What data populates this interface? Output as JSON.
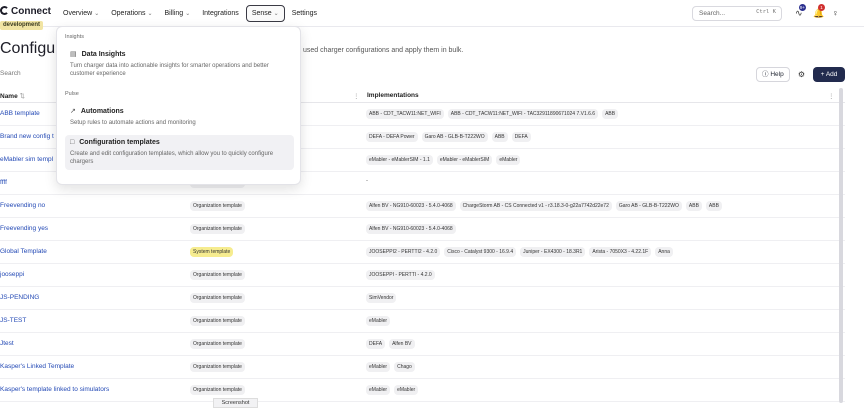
{
  "app": {
    "logo": "Connect",
    "env_badge": "development"
  },
  "nav": [
    {
      "label": "Overview",
      "chevron": true
    },
    {
      "label": "Operations",
      "chevron": true
    },
    {
      "label": "Billing",
      "chevron": true
    },
    {
      "label": "Integrations",
      "chevron": false
    },
    {
      "label": "Sense",
      "chevron": true,
      "active": true
    },
    {
      "label": "Settings",
      "chevron": false
    }
  ],
  "search": {
    "placeholder": "Search...",
    "shortcut": "Ctrl K"
  },
  "header_icons": {
    "activity": "activity-icon",
    "activity_badge": "9+",
    "bell": "bell-icon",
    "bell_badge": "1",
    "user": "user-icon"
  },
  "page": {
    "title": "Configura",
    "subtitle": "used charger configurations and apply them in bulk.",
    "filter_placeholder": "Search",
    "help_label": "Help",
    "add_label": "+ Add"
  },
  "table": {
    "columns": [
      "Name",
      "Implementations"
    ],
    "rows": [
      {
        "name": "ABB template",
        "type": "",
        "impls": [
          "ABB - CDT_TACW11:NET_WIFI",
          "ABB - CDT_TACW11:NET_WIFI - TAC32911890671024 7.V1.6.6",
          "ABB"
        ]
      },
      {
        "name": "Brand new config t",
        "type": "",
        "impls": [
          "DEFA - DEFA Power",
          "Garo AB - GLB-B-T222WO",
          "ABB",
          "DEFA"
        ]
      },
      {
        "name": "eMabler sim templ",
        "type": "",
        "impls": [
          "eMabler - eMablerSIM - 1.1",
          "eMabler - eMablerSIM",
          "eMabler"
        ]
      },
      {
        "name": "ffff",
        "type": "Organization template",
        "impls": [],
        "plain": "-"
      },
      {
        "name": "Freevending no",
        "type": "Organization template",
        "impls": [
          "Alfen BV - NG910-60023 - 5.4.0-4068",
          "ChargeStorm AB - CS Connected v1 - r3.18.3-0-g22a7742d22e72",
          "Garo AB - GLB-B-T222WO",
          "ABB",
          "ABB"
        ]
      },
      {
        "name": "Freevending yes",
        "type": "Organization template",
        "impls": [
          "Alfen BV - NG910-60023 - 5.4.0-4068"
        ]
      },
      {
        "name": "Global Template",
        "type": "System template",
        "sys": true,
        "impls": [
          "JOOSEPPI2 - PERTTI2 - 4.2.0",
          "Cisco - Catalyst 9300 - 16.9.4",
          "Juniper - EX4300 - 18.3R1",
          "Arista - 7050X3 - 4.22.1F",
          "Anna"
        ]
      },
      {
        "name": "jooseppi",
        "type": "Organization template",
        "impls": [
          "JOOSEPPI - PERTTI - 4.2.0"
        ]
      },
      {
        "name": "JS-PENDING",
        "type": "Organization template",
        "impls": [
          "SimVendor"
        ]
      },
      {
        "name": "JS-TEST",
        "type": "Organization template",
        "impls": [
          "eMabler"
        ]
      },
      {
        "name": "Jtest",
        "type": "Organization template",
        "impls": [
          "DEFA",
          "Alfen BV"
        ]
      },
      {
        "name": "Kasper's Linked Template",
        "type": "Organization template",
        "impls": [
          "eMabler",
          "Chago"
        ]
      },
      {
        "name": "Kasper's template linked to simulators",
        "type": "Organization template",
        "impls": [
          "eMabler",
          "eMabler"
        ]
      }
    ]
  },
  "dropdown": {
    "insights_heading": "Insights",
    "data_insights_title": "Data Insights",
    "data_insights_desc": "Turn charger data into actionable insights for smarter operations and better customer experience",
    "pulse_heading": "Pulse",
    "automations_title": "Automations",
    "automations_desc": "Setup rules to automate actions and monitoring",
    "config_title": "Configuration templates",
    "config_desc": "Create and edit configuration templates, which allow you to quickly configure chargers"
  },
  "tooltip": "Screenshot"
}
